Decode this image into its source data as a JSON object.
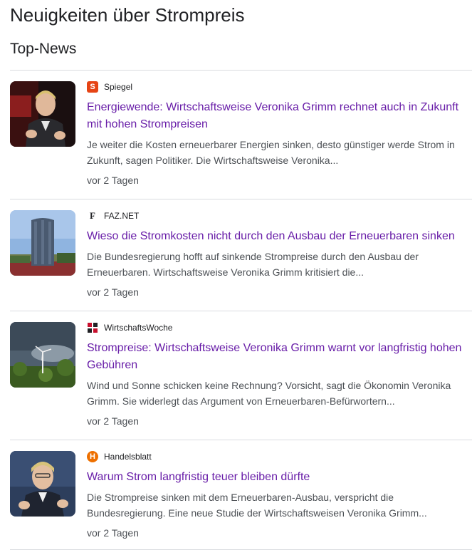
{
  "page": {
    "title": "Neuigkeiten über Strompreis"
  },
  "section": {
    "title": "Top-News"
  },
  "articles": [
    {
      "source": "Spiegel",
      "source_icon": "spiegel-logo-icon",
      "headline": "Energiewende: Wirtschaftsweise Veronika Grimm rechnet auch in Zukunft mit hohen Strompreisen",
      "snippet": "Je weiter die Kosten erneuerbarer Energien sinken, desto günstiger werde Strom in Zukunft, sagen Politiker. Die Wirtschaftsweise Veronika...",
      "time": "vor 2 Tagen"
    },
    {
      "source": "FAZ.NET",
      "source_icon": "faz-logo-icon",
      "headline": "Wieso die Stromkosten nicht durch den Ausbau der Erneuerbaren sinken",
      "snippet": "Die Bundesregierung hofft auf sinkende Strompreise durch den Ausbau der Erneuerbaren. Wirtschaftsweise Veronika Grimm kritisiert die...",
      "time": "vor 2 Tagen"
    },
    {
      "source": "WirtschaftsWoche",
      "source_icon": "wiwo-logo-icon",
      "headline": "Strompreise: Wirtschaftsweise Veronika Grimm warnt vor langfristig hohen Gebühren",
      "snippet": "Wind und Sonne schicken keine Rechnung? Vorsicht, sagt die Ökonomin Veronika Grimm. Sie widerlegt das Argument von Erneuerbaren-Befürwortern...",
      "time": "vor 2 Tagen"
    },
    {
      "source": "Handelsblatt",
      "source_icon": "handelsblatt-logo-icon",
      "headline": "Warum Strom langfristig teuer bleiben dürfte",
      "snippet": "Die Strompreise sinken mit dem Erneuerbaren-Ausbau, verspricht die Bundesregierung. Eine neue Studie der Wirtschaftsweisen Veronika Grimm...",
      "time": "vor 2 Tagen"
    }
  ],
  "colors": {
    "headline_visited": "#681da8",
    "spiegel": "#e64415",
    "handelsblatt": "#ee7000",
    "wiwo": "#c8102e"
  },
  "icons": {
    "spiegel": "S",
    "handelsblatt": "H",
    "faz": "F"
  }
}
